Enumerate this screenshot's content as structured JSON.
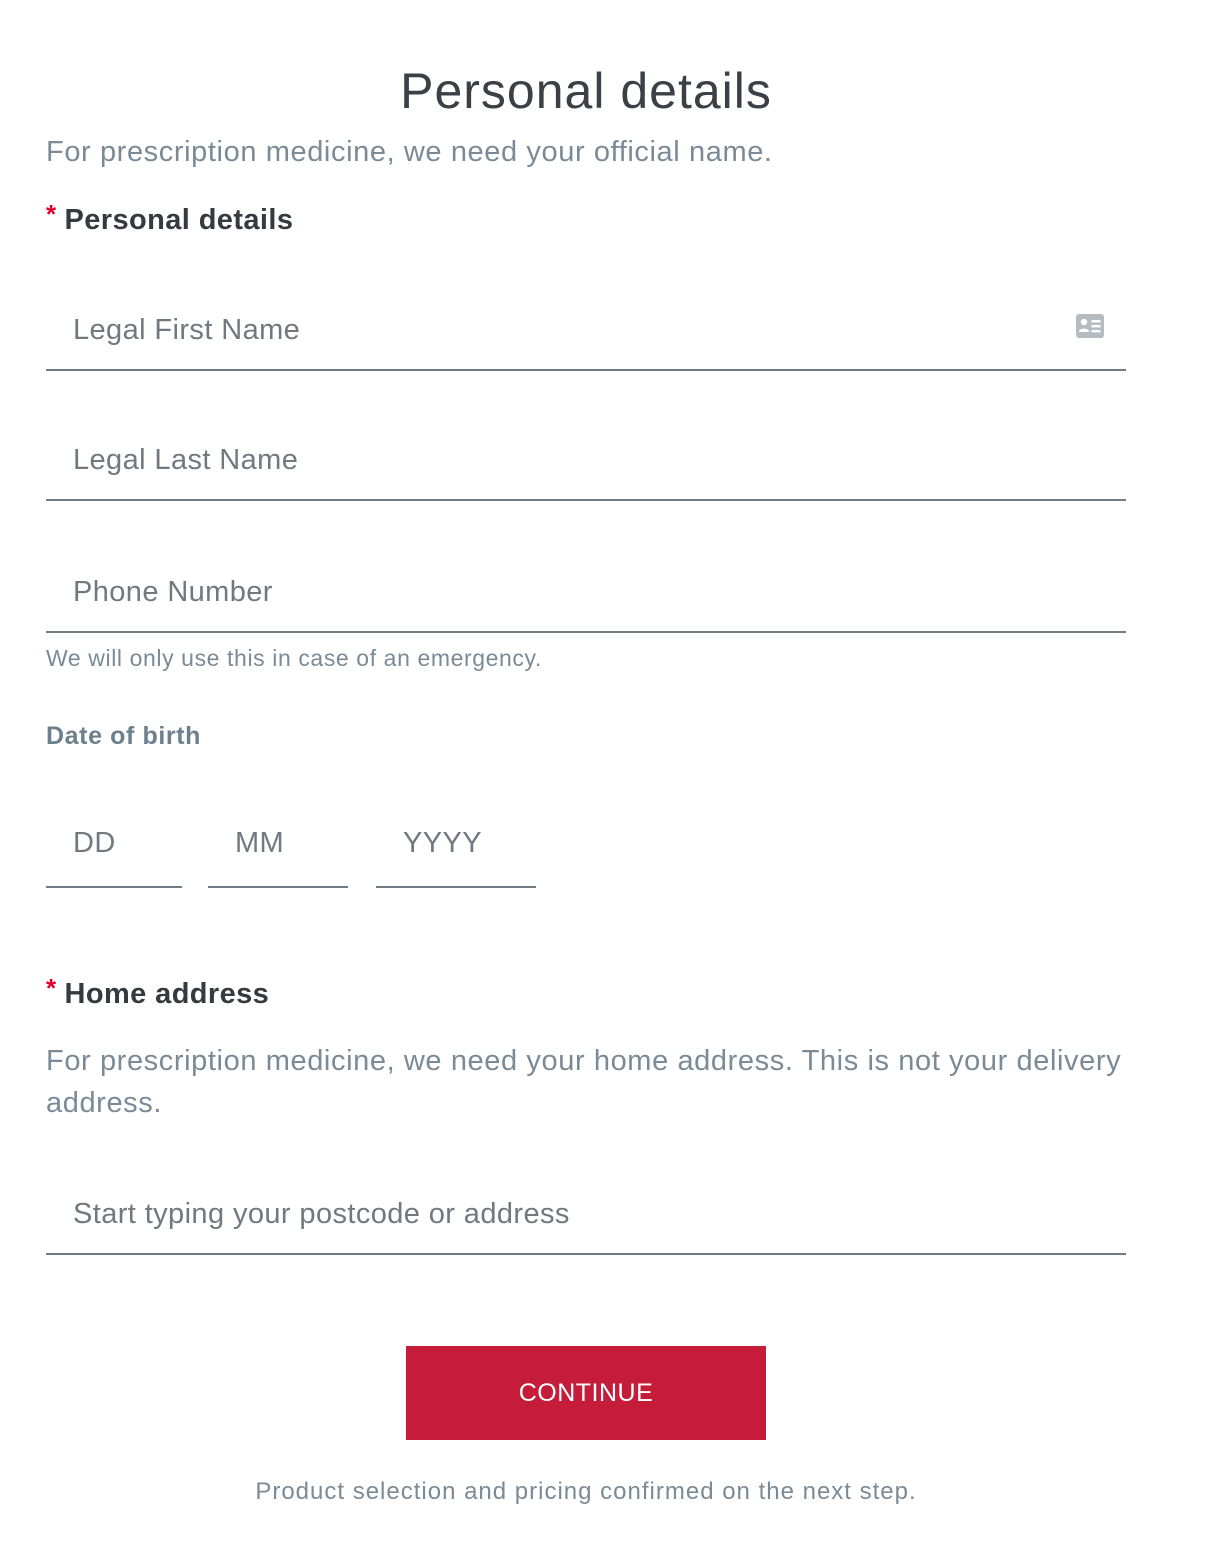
{
  "page": {
    "title": "Personal details",
    "intro": "For prescription medicine, we need your official name."
  },
  "personal_section": {
    "required_marker": "*",
    "label": "Personal details"
  },
  "fields": {
    "first_name": {
      "value": "",
      "placeholder": "Legal First Name",
      "icon": "contact-card-icon"
    },
    "last_name": {
      "value": "",
      "placeholder": "Legal Last Name"
    },
    "phone": {
      "value": "",
      "placeholder": "Phone Number",
      "helper": "We will only use this in case of an emergency."
    }
  },
  "dob": {
    "label": "Date of birth",
    "day": {
      "value": "",
      "placeholder": "DD"
    },
    "month": {
      "value": "",
      "placeholder": "MM"
    },
    "year": {
      "value": "",
      "placeholder": "YYYY"
    }
  },
  "address_section": {
    "required_marker": "*",
    "label": "Home address",
    "help": "For prescription medicine, we need your home address. This is not your delivery address.",
    "search": {
      "value": "",
      "placeholder": "Start typing your postcode or address"
    }
  },
  "actions": {
    "continue_label": "CONTINUE",
    "footnote": "Product selection and pricing confirmed on the next step."
  },
  "colors": {
    "accent": "#c41c39",
    "required": "#e4002b",
    "muted_text": "#7a8a96",
    "field_border": "#717d86"
  }
}
